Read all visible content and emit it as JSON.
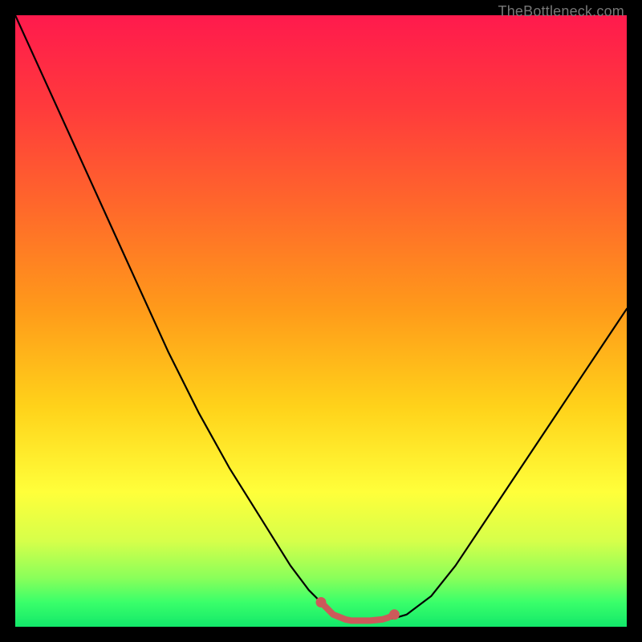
{
  "watermark": "TheBottleneck.com",
  "chart_data": {
    "type": "line",
    "title": "",
    "xlabel": "",
    "ylabel": "",
    "xlim": [
      0,
      100
    ],
    "ylim": [
      0,
      100
    ],
    "grid": false,
    "legend": false,
    "series": [
      {
        "name": "main-curve",
        "color": "#000000",
        "x": [
          0,
          5,
          10,
          15,
          20,
          25,
          30,
          35,
          40,
          45,
          48,
          50,
          52,
          54,
          56,
          58,
          60,
          62,
          64,
          68,
          72,
          76,
          80,
          84,
          88,
          92,
          96,
          100
        ],
        "values": [
          100,
          89,
          78,
          67,
          56,
          45,
          35,
          26,
          18,
          10,
          6,
          4,
          2,
          1.2,
          1,
          1,
          1.1,
          1.4,
          2,
          5,
          10,
          16,
          22,
          28,
          34,
          40,
          46,
          52
        ]
      },
      {
        "name": "bottom-marker",
        "color": "#cc5a5a",
        "x": [
          50,
          52,
          54,
          55,
          56,
          57,
          58,
          59,
          60,
          61,
          62
        ],
        "values": [
          4.0,
          2.0,
          1.2,
          1.0,
          1.0,
          1.0,
          1.0,
          1.1,
          1.2,
          1.5,
          2.0
        ]
      }
    ],
    "background_gradient": {
      "direction": "vertical",
      "stops": [
        {
          "pos": 0.0,
          "color": "#ff1a4d"
        },
        {
          "pos": 0.15,
          "color": "#ff3a3c"
        },
        {
          "pos": 0.32,
          "color": "#ff6a2a"
        },
        {
          "pos": 0.48,
          "color": "#ff9a1a"
        },
        {
          "pos": 0.64,
          "color": "#ffd21a"
        },
        {
          "pos": 0.78,
          "color": "#ffff3a"
        },
        {
          "pos": 0.86,
          "color": "#d6ff4a"
        },
        {
          "pos": 0.92,
          "color": "#8aff5a"
        },
        {
          "pos": 0.96,
          "color": "#3aff6a"
        },
        {
          "pos": 1.0,
          "color": "#12e86a"
        }
      ]
    }
  }
}
